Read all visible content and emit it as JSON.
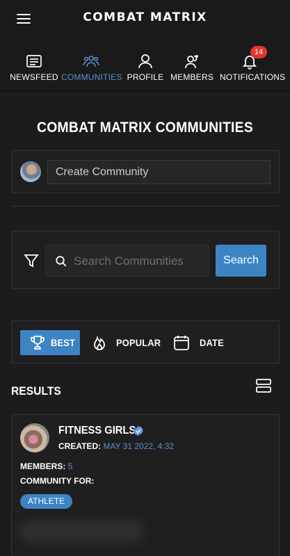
{
  "app": {
    "title": "COMBAT MATRIX"
  },
  "nav": {
    "items": [
      {
        "label": "NEWSFEED",
        "icon": "newsfeed-icon"
      },
      {
        "label": "COMMUNITIES",
        "icon": "communities-icon",
        "active": true
      },
      {
        "label": "PROFILE",
        "icon": "profile-icon"
      },
      {
        "label": "MEMBERS",
        "icon": "members-icon"
      },
      {
        "label": "NOTIFICATIONS",
        "icon": "bell-icon",
        "badge": "14"
      }
    ]
  },
  "page": {
    "heading": "COMBAT MATRIX COMMUNITIES"
  },
  "create": {
    "placeholder": "Create Community"
  },
  "search": {
    "placeholder": "Search Communities",
    "button_label": "Search"
  },
  "sort": {
    "options": [
      {
        "label": "BEST",
        "icon": "trophy-icon",
        "selected": true
      },
      {
        "label": "POPULAR",
        "icon": "flame-icon"
      },
      {
        "label": "DATE",
        "icon": "calendar-icon"
      }
    ]
  },
  "results": {
    "title": "RESULTS",
    "items": [
      {
        "name": "FITNESS GIRLS",
        "verified": true,
        "created_label": "CREATED:",
        "created_value": "MAY 31 2022, 4:32",
        "members_label": "MEMBERS:",
        "members_value": "5",
        "community_for_label": "COMMUNITY FOR:",
        "tag": "ATHLETE"
      }
    ]
  },
  "colors": {
    "accent": "#3d84c4",
    "accent_text": "#5b8fd0",
    "badge": "#e3342f",
    "background": "#1c1c1c"
  }
}
